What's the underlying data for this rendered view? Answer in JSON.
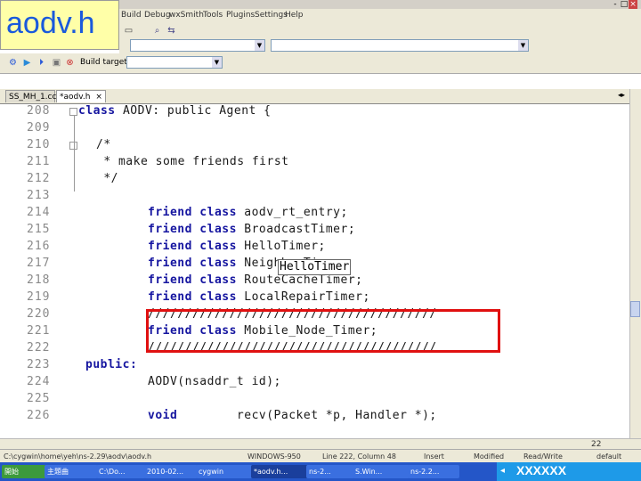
{
  "overlay_label": "aodv.h",
  "window": {
    "btn_min": "-",
    "btn_max": "□",
    "btn_close": "×"
  },
  "menubar": {
    "items": [
      "Build",
      "Debug",
      "wxSmith",
      "Tools",
      "Plugins",
      "Settings",
      "Help"
    ]
  },
  "toolbar": {
    "build_target_label": "Build target:"
  },
  "tabs": [
    {
      "label": "SS_MH_1.cc"
    },
    {
      "label": "*aodv.h"
    }
  ],
  "tab_close": "×",
  "tooltip": "HelloTimer",
  "code_lines": [
    {
      "num": "208",
      "text": "class AODV: public Agent {"
    },
    {
      "num": "209",
      "text": ""
    },
    {
      "num": "210",
      "text": "/*"
    },
    {
      "num": "211",
      "text": " * make some friends first"
    },
    {
      "num": "212",
      "text": " */"
    },
    {
      "num": "213",
      "text": ""
    },
    {
      "num": "214",
      "text": "friend class aodv_rt_entry;"
    },
    {
      "num": "215",
      "text": "friend class BroadcastTimer;"
    },
    {
      "num": "216",
      "text": "friend class HelloTimer;"
    },
    {
      "num": "217",
      "text": "friend class NeighborTimer;"
    },
    {
      "num": "218",
      "text": "friend class RouteCacheTimer;"
    },
    {
      "num": "219",
      "text": "friend class LocalRepairTimer;"
    },
    {
      "num": "220",
      "text": "///////////////////////////////////////"
    },
    {
      "num": "221",
      "text": "friend class Mobile_Node_Timer;"
    },
    {
      "num": "222",
      "text": "///////////////////////////////////////"
    },
    {
      "num": "223",
      "text": "public:"
    },
    {
      "num": "224",
      "text": "AODV(nsaddr_t id);"
    },
    {
      "num": "225",
      "text": ""
    },
    {
      "num": "226",
      "text": "void        recv(Packet *p, Handler *);"
    }
  ],
  "page_number": "22",
  "statusbar": {
    "path": "C:\\cygwin\\home\\yeh\\ns-2.29\\aodv\\aodv.h",
    "encoding": "WINDOWS-950",
    "position": "Line 222, Column 48",
    "insert": "Insert",
    "modified": "Modified",
    "rw": "Read/Write",
    "profile": "default"
  },
  "taskbar": {
    "items": [
      "開始",
      "主題曲",
      "C:\\Do...",
      "2010-02...",
      "cygwin",
      "*aodv.h...",
      "ns-2...",
      "S.Win...",
      "ns-2.2..."
    ],
    "tray_text": "XXXXXX"
  },
  "colors": {
    "keyword": "#1616a0",
    "highlight_box": "#e01010",
    "taskbar": "#2456c8"
  }
}
